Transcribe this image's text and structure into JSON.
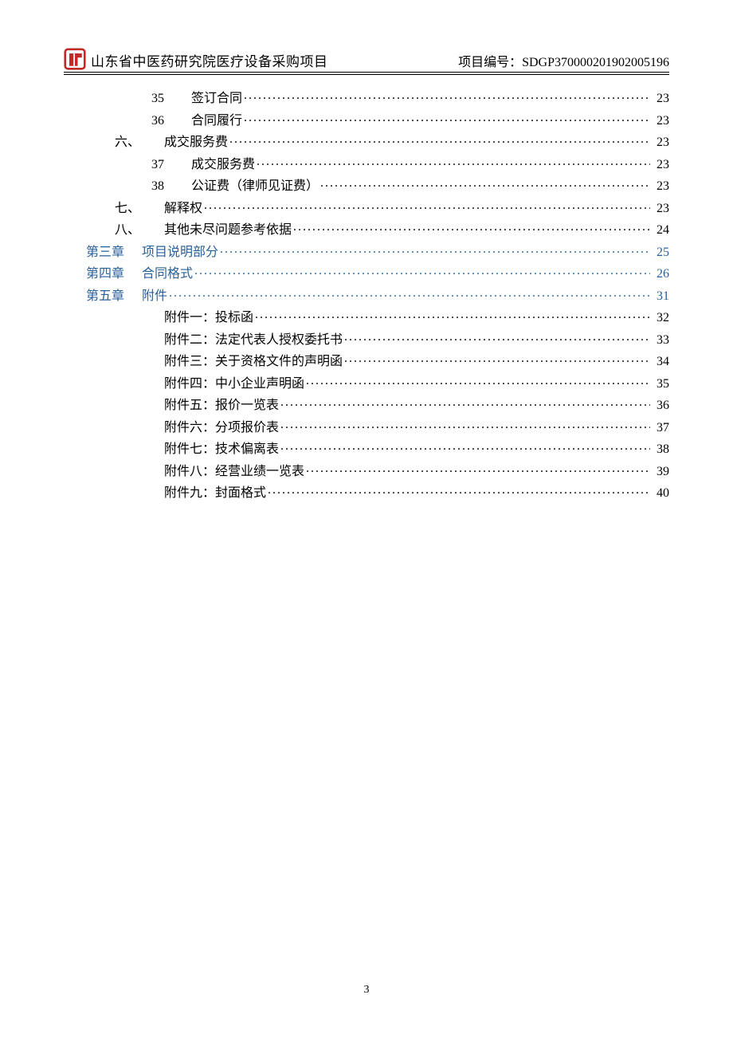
{
  "header": {
    "title": "山东省中医药研究院医疗设备采购项目",
    "project_label": "项目编号：",
    "project_id": "SDGP370000201902005196"
  },
  "logo_color": "#c12a2a",
  "chapter_color": "#2a6099",
  "toc": [
    {
      "level": "num",
      "prefix": "35",
      "label": "签订合同",
      "page": "23"
    },
    {
      "level": "num",
      "prefix": "36",
      "label": "合同履行",
      "page": "23"
    },
    {
      "level": "cn",
      "prefix": "六、",
      "label": "成交服务费",
      "page": "23"
    },
    {
      "level": "num",
      "prefix": "37",
      "label": "成交服务费",
      "page": "23"
    },
    {
      "level": "num",
      "prefix": "38",
      "label": "公证费（律师见证费）",
      "page": "23"
    },
    {
      "level": "cn",
      "prefix": "七、",
      "label": "解释权",
      "page": "23"
    },
    {
      "level": "cn",
      "prefix": "八、",
      "label": "其他未尽问题参考依据",
      "page": "24"
    },
    {
      "level": "chap",
      "prefix": "第三章",
      "label": "项目说明部分",
      "page": "25",
      "chapter": true
    },
    {
      "level": "chap",
      "prefix": "第四章",
      "label": "合同格式",
      "page": "26",
      "chapter": true
    },
    {
      "level": "chap",
      "prefix": "第五章",
      "label": "附件",
      "page": "31",
      "chapter": true
    },
    {
      "level": "attach",
      "prefix": "",
      "label": "附件一：投标函",
      "page": "32"
    },
    {
      "level": "attach",
      "prefix": "",
      "label": "附件二：法定代表人授权委托书",
      "page": "33"
    },
    {
      "level": "attach",
      "prefix": "",
      "label": "附件三：关于资格文件的声明函",
      "page": "34"
    },
    {
      "level": "attach",
      "prefix": "",
      "label": "附件四：中小企业声明函",
      "page": "35"
    },
    {
      "level": "attach",
      "prefix": "",
      "label": "附件五：报价一览表",
      "page": "36"
    },
    {
      "level": "attach",
      "prefix": "",
      "label": "附件六：分项报价表",
      "page": "37"
    },
    {
      "level": "attach",
      "prefix": "",
      "label": "附件七：技术偏离表",
      "page": "38"
    },
    {
      "level": "attach",
      "prefix": "",
      "label": "附件八：经营业绩一览表",
      "page": "39"
    },
    {
      "level": "attach",
      "prefix": "",
      "label": "附件九：封面格式",
      "page": "40"
    }
  ],
  "footer": {
    "page_number": "3"
  }
}
